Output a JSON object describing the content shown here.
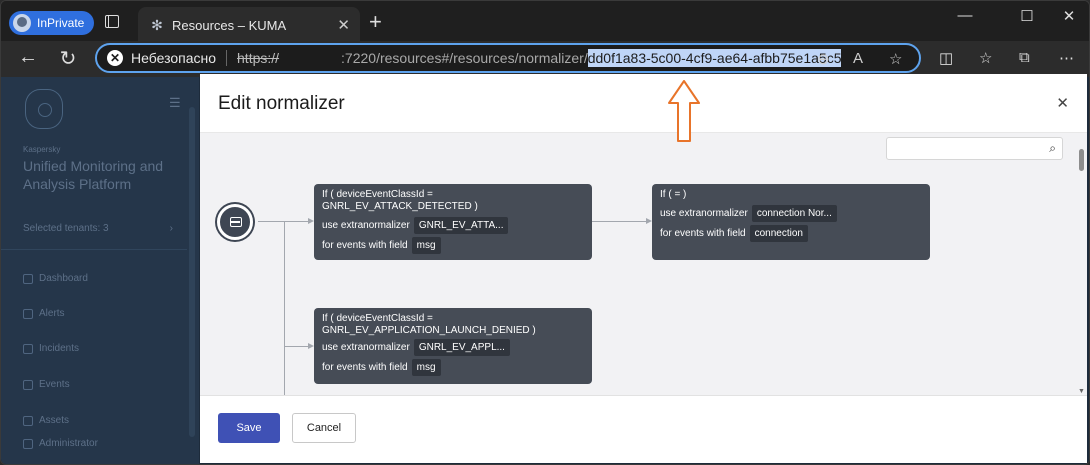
{
  "browser": {
    "profile_label": "InPrivate",
    "tab_title": "Resources – KUMA",
    "address": {
      "insecure_label": "Небезопасно",
      "scheme": "https://",
      "path": ":7220/resources#/resources/normalizer/",
      "selected_id": "dd0f1a83-5c00-4cf9-ae64-afbb75e1a5c5"
    }
  },
  "sidebar": {
    "brand_small": "Kaspersky",
    "brand_title": "Unified Monitoring and Analysis Platform",
    "tenants": "Selected tenants: 3",
    "items": [
      {
        "label": "Dashboard"
      },
      {
        "label": "Alerts"
      },
      {
        "label": "Incidents"
      },
      {
        "label": "Events"
      },
      {
        "label": "Assets"
      },
      {
        "label": "Administrator"
      }
    ]
  },
  "modal": {
    "title": "Edit normalizer",
    "save_label": "Save",
    "cancel_label": "Cancel",
    "search_placeholder": ""
  },
  "nodes": [
    {
      "condition": "If ( deviceEventClassId = GNRL_EV_ATTACK_DETECTED )",
      "extra_label": "use extranormalizer",
      "extra_value": "GNRL_EV_ATTA...",
      "field_label": "for events with field",
      "field_value": "msg"
    },
    {
      "condition": "If ( = )",
      "extra_label": "use extranormalizer",
      "extra_value": "connection Nor...",
      "field_label": "for events with field",
      "field_value": "connection"
    },
    {
      "condition_line1": "If ( deviceEventClassId =",
      "condition_line2": "GNRL_EV_APPLICATION_LAUNCH_DENIED )",
      "extra_label": "use extranormalizer",
      "extra_value": "GNRL_EV_APPL...",
      "field_label": "for events with field",
      "field_value": "msg"
    }
  ],
  "colors": {
    "accent": "#3f51b5",
    "annotation_arrow": "#e8742a",
    "url_highlight": "#bfd5f7"
  }
}
